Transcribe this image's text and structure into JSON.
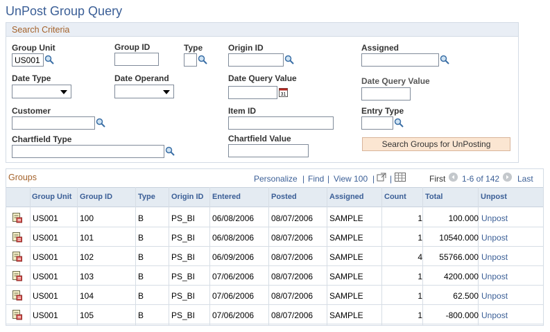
{
  "page_title": "UnPost Group Query",
  "search_criteria": {
    "header": "Search Criteria",
    "group_unit": {
      "label": "Group Unit",
      "value": "US001"
    },
    "group_id": {
      "label": "Group ID",
      "value": ""
    },
    "type": {
      "label": "Type",
      "value": ""
    },
    "origin_id": {
      "label": "Origin ID",
      "value": ""
    },
    "assigned": {
      "label": "Assigned",
      "value": ""
    },
    "date_type": {
      "label": "Date Type",
      "value": ""
    },
    "date_operand": {
      "label": "Date Operand",
      "value": ""
    },
    "date_query_value_1": {
      "label": "Date Query Value",
      "value": ""
    },
    "date_query_value_2": {
      "label": "Date Query Value",
      "value": ""
    },
    "customer": {
      "label": "Customer",
      "value": ""
    },
    "item_id": {
      "label": "Item ID",
      "value": ""
    },
    "entry_type": {
      "label": "Entry Type",
      "value": ""
    },
    "chartfield_type": {
      "label": "Chartfield Type",
      "value": ""
    },
    "chartfield_value": {
      "label": "Chartfield Value",
      "value": ""
    },
    "search_button": "Search Groups for UnPosting"
  },
  "groups": {
    "title": "Groups",
    "nav": {
      "personalize": "Personalize",
      "find": "Find",
      "view": "View 100",
      "first": "First",
      "range": "1-6 of 142",
      "last": "Last"
    },
    "columns": [
      "Group Unit",
      "Group ID",
      "Type",
      "Origin ID",
      "Entered",
      "Posted",
      "Assigned",
      "Count",
      "Total",
      "Unpost"
    ],
    "rows": [
      [
        "US001",
        "100",
        "B",
        "PS_BI",
        "06/08/2006",
        "08/07/2006",
        "SAMPLE",
        "1",
        "100.000",
        "Unpost"
      ],
      [
        "US001",
        "101",
        "B",
        "PS_BI",
        "06/08/2006",
        "08/07/2006",
        "SAMPLE",
        "1",
        "10540.000",
        "Unpost"
      ],
      [
        "US001",
        "102",
        "B",
        "PS_BI",
        "06/09/2006",
        "08/07/2006",
        "SAMPLE",
        "4",
        "55766.000",
        "Unpost"
      ],
      [
        "US001",
        "103",
        "B",
        "PS_BI",
        "07/06/2006",
        "08/07/2006",
        "SAMPLE",
        "1",
        "4200.000",
        "Unpost"
      ],
      [
        "US001",
        "104",
        "B",
        "PS_BI",
        "07/06/2006",
        "08/07/2006",
        "SAMPLE",
        "1",
        "62.500",
        "Unpost"
      ],
      [
        "US001",
        "105",
        "B",
        "PS_BI",
        "07/06/2006",
        "08/07/2006",
        "SAMPLE",
        "1",
        "-800.000",
        "Unpost"
      ]
    ]
  },
  "colors": {
    "title": "#3a5e96",
    "section_header": "#a4622a",
    "link": "#3a5e96",
    "button_bg": "#fbe6d2"
  }
}
